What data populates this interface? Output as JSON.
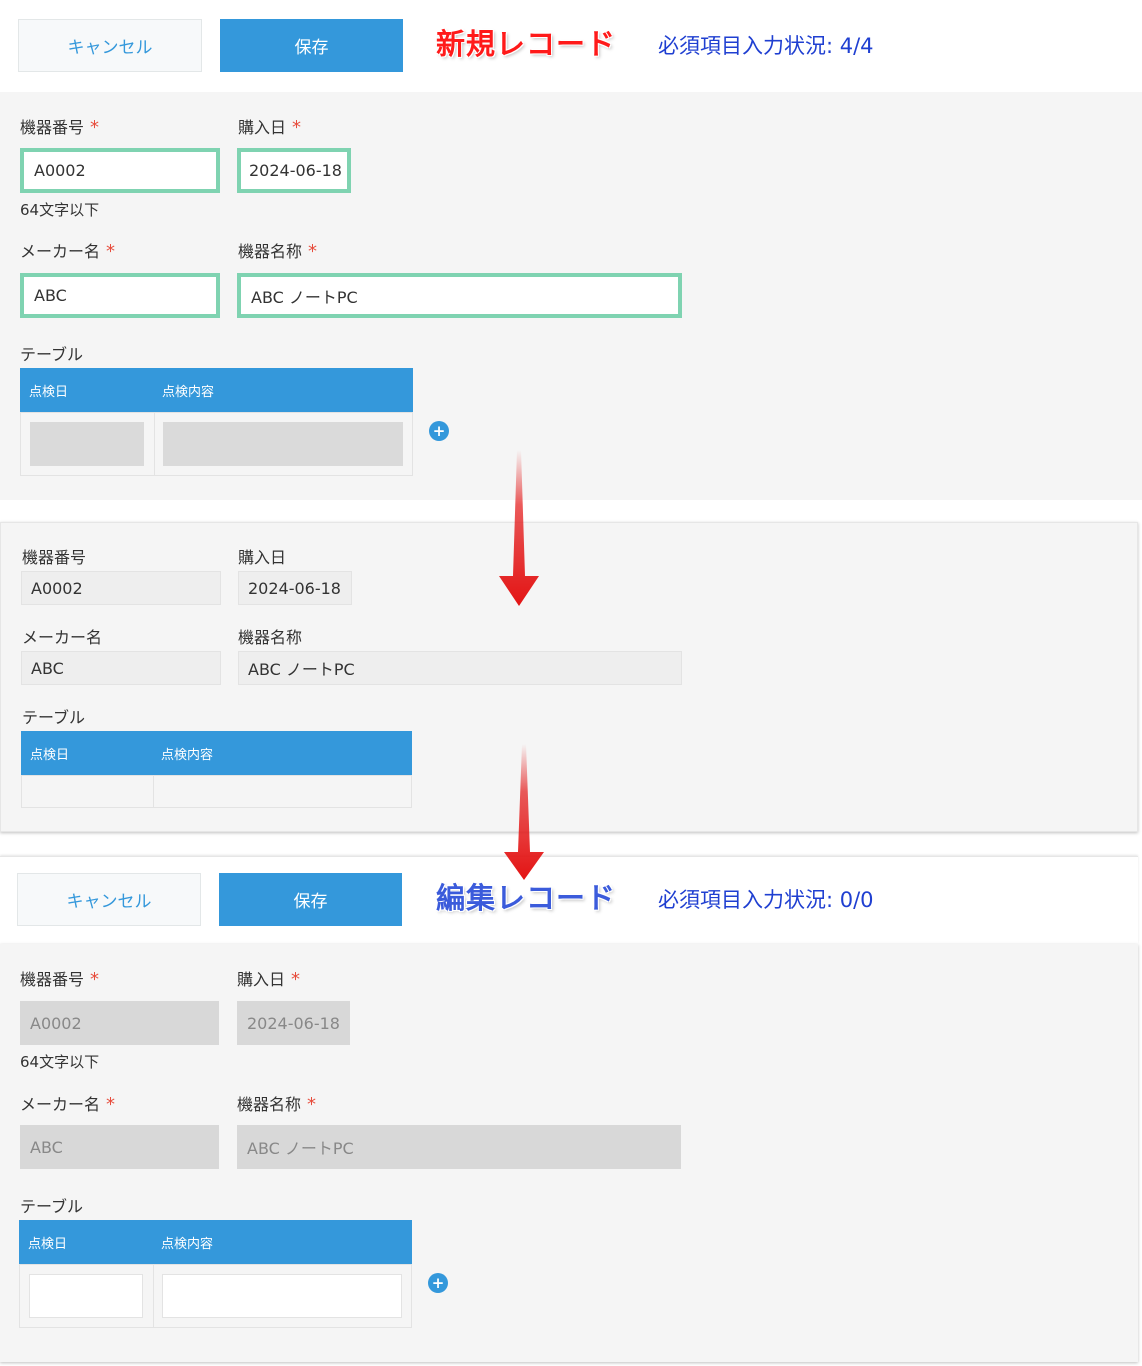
{
  "new_record": {
    "cancel_label": "キャンセル",
    "save_label": "保存",
    "title": "新規レコード",
    "status": "必須項目入力状況: 4/4",
    "fields": {
      "device_no_label": "機器番号",
      "device_no_value": "A0002",
      "device_no_note": "64文字以下",
      "purchase_date_label": "購入日",
      "purchase_date_value": "2024-06-18",
      "maker_label": "メーカー名",
      "maker_value": "ABC",
      "device_name_label": "機器名称",
      "device_name_value": "ABC ノートPC"
    },
    "table": {
      "label": "テーブル",
      "col_date": "点検日",
      "col_content": "点検内容"
    }
  },
  "detail_view": {
    "fields": {
      "device_no_label": "機器番号",
      "device_no_value": "A0002",
      "purchase_date_label": "購入日",
      "purchase_date_value": "2024-06-18",
      "maker_label": "メーカー名",
      "maker_value": "ABC",
      "device_name_label": "機器名称",
      "device_name_value": "ABC ノートPC"
    },
    "table": {
      "label": "テーブル",
      "col_date": "点検日",
      "col_content": "点検内容"
    }
  },
  "edit_record": {
    "cancel_label": "キャンセル",
    "save_label": "保存",
    "title": "編集レコード",
    "status": "必須項目入力状況: 0/0",
    "fields": {
      "device_no_label": "機器番号",
      "device_no_value": "A0002",
      "device_no_note": "64文字以下",
      "purchase_date_label": "購入日",
      "purchase_date_value": "2024-06-18",
      "maker_label": "メーカー名",
      "maker_value": "ABC",
      "device_name_label": "機器名称",
      "device_name_value": "ABC ノートPC"
    },
    "table": {
      "label": "テーブル",
      "col_date": "点検日",
      "col_content": "点検内容"
    }
  },
  "required_mark": "*",
  "add_row_symbol": "+",
  "colors": {
    "accent": "#3498db",
    "title_new": "#ff1a1a",
    "title_edit": "#3b5bdb",
    "status_text": "#1f3fd1",
    "valid_border": "#7fd3b1",
    "required_mark": "#e74c3c",
    "arrow": "#e31414"
  }
}
